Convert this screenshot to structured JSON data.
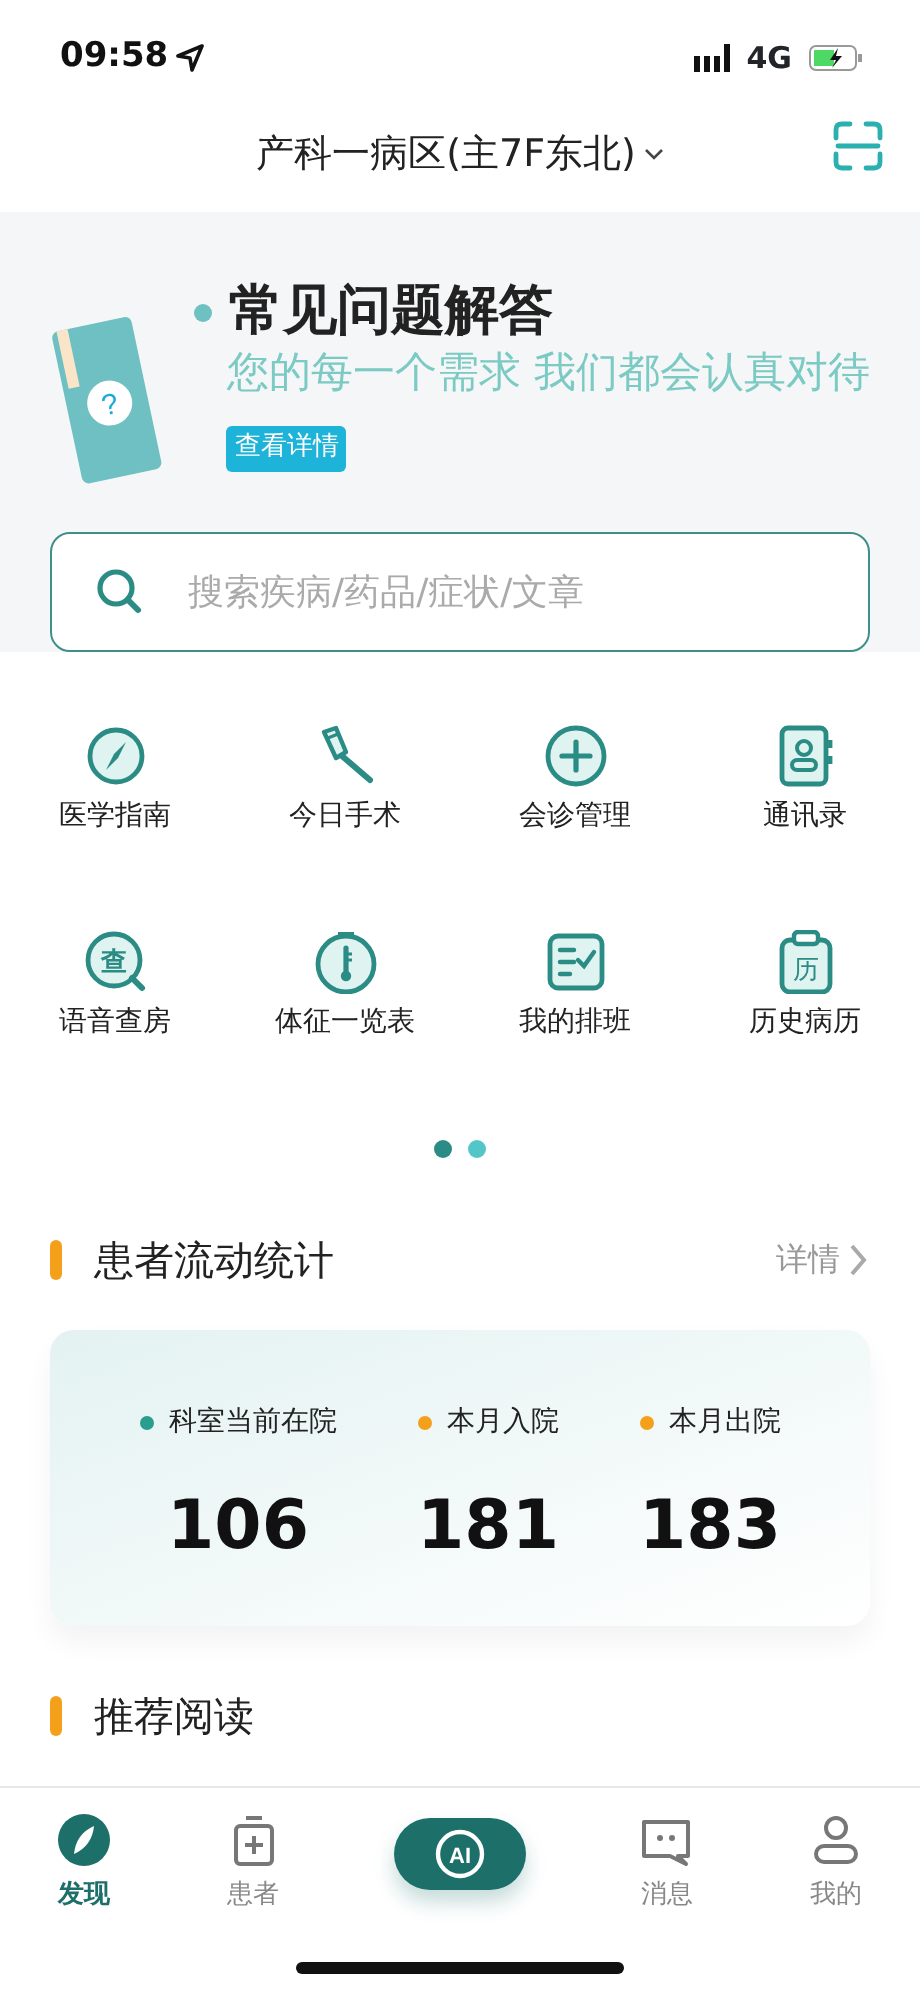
{
  "status_bar": {
    "time": "09:58",
    "network": "4G"
  },
  "header": {
    "title": "产科一病区(主7F东北)"
  },
  "banner": {
    "title": "常见问题解答",
    "subtitle": "您的每一个需求 我们都会认真对待",
    "button": "查看详情",
    "illustration_mark": "?"
  },
  "search": {
    "placeholder": "搜索疾病/药品/症状/文章"
  },
  "shortcuts": [
    {
      "label": "医学指南"
    },
    {
      "label": "今日手术"
    },
    {
      "label": "会诊管理"
    },
    {
      "label": "通讯录"
    },
    {
      "label": "语音查房",
      "icon_text": "查"
    },
    {
      "label": "体征一览表"
    },
    {
      "label": "我的排班"
    },
    {
      "label": "历史病历",
      "icon_text": "历"
    }
  ],
  "pager": [
    {
      "selected": true
    },
    {
      "selected": false
    }
  ],
  "patient_flow": {
    "title": "患者流动统计",
    "more": "详情",
    "stats": [
      {
        "label": "科室当前在院",
        "value": "106",
        "color": "#2a9d8f"
      },
      {
        "label": "本月入院",
        "value": "181",
        "color": "#f5a01a"
      },
      {
        "label": "本月出院",
        "value": "183",
        "color": "#f5a01a"
      }
    ]
  },
  "next_section": {
    "title": "推荐阅读"
  },
  "tab_bar": [
    {
      "kind": "tab",
      "label": "发现",
      "selected": true
    },
    {
      "kind": "tab",
      "label": "患者",
      "selected": false
    },
    {
      "kind": "ai",
      "label": "AI",
      "selected": false
    },
    {
      "kind": "tab",
      "label": "消息",
      "selected": false
    },
    {
      "kind": "tab",
      "label": "我的",
      "selected": false
    }
  ]
}
